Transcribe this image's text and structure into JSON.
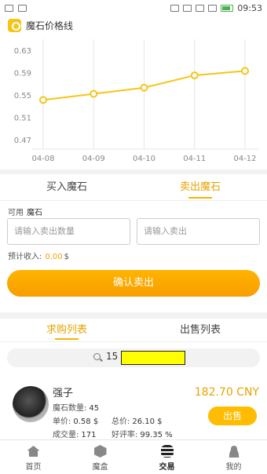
{
  "status_bar": {
    "time": "09:53"
  },
  "chart": {
    "title": "魔石价格线"
  },
  "chart_data": {
    "type": "line",
    "title": "魔石价格线",
    "categories": [
      "04-08",
      "04-09",
      "04-10",
      "04-11",
      "04-12"
    ],
    "series": [
      {
        "values": [
          0.541,
          0.552,
          0.563,
          0.585,
          0.593
        ]
      }
    ],
    "y_ticks": [
      "0.63",
      "0.59",
      "0.55",
      "0.51",
      "0.47"
    ],
    "ylim": [
      0.47,
      0.63
    ],
    "grid": "vertical",
    "colors": {
      "line": "#f5c518",
      "grid": "#e6e6e6",
      "axis_text": "#888888"
    }
  },
  "trade": {
    "tabs": [
      {
        "label": "买入魔石",
        "active": false
      },
      {
        "label": "卖出魔石",
        "active": true
      }
    ],
    "available_label": "可用",
    "available_unit": "魔石",
    "quantity_placeholder": "请输入卖出数量",
    "price_placeholder": "请输入卖出",
    "expected_label": "预计收入:",
    "expected_value": "0.00",
    "expected_unit": "$",
    "confirm_label": "确认卖出"
  },
  "list": {
    "tabs": [
      {
        "label": "求购列表",
        "active": true
      },
      {
        "label": "出售列表",
        "active": false
      }
    ],
    "search_value": "15",
    "seller": {
      "name": "强子",
      "qty_label": "魔石数量:",
      "qty_value": "45",
      "unit_price_label": "单价:",
      "unit_price_value": "0.58 $",
      "total_label": "总价:",
      "total_value": "26.10 $",
      "volume_label": "成交量:",
      "volume_value": "171",
      "rating_label": "好评率:",
      "rating_value": "99.35 %",
      "price": "182.70 CNY",
      "sell_label": "出售"
    }
  },
  "nav": {
    "items": [
      {
        "label": "首页",
        "icon": "home-icon",
        "active": false
      },
      {
        "label": "魔盒",
        "icon": "box-icon",
        "active": false
      },
      {
        "label": "交易",
        "icon": "coins-icon",
        "active": true
      },
      {
        "label": "我的",
        "icon": "user-icon",
        "active": false
      }
    ]
  }
}
